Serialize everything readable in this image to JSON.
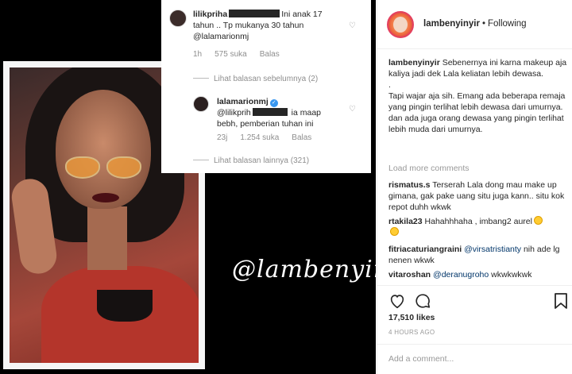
{
  "overlay": {
    "comment1": {
      "username": "lilikpriha",
      "text_before": "Ini anak 17",
      "text_line2": "tahun .. Tp mukanya 30 tahun",
      "text_line3": "@lalamarionmj",
      "age": "1h",
      "likes": "575 suka",
      "reply": "Balas"
    },
    "prev_replies": "Lihat balasan sebelumnya (2)",
    "comment2": {
      "username": "lalamarionmj",
      "verified_icon": "✓",
      "text_line1_mention": "@lilikprih",
      "text_line1_rest": "ia maap",
      "text_line2": "bebh, pemberian tuhan ini",
      "age": "23j",
      "likes": "1.254 suka",
      "reply": "Balas"
    },
    "more_replies": "Lihat balasan lainnya (321)"
  },
  "watermark": "@lambenyinyir",
  "post": {
    "username": "lambenyinyir",
    "separator": "•",
    "follow_label": "Following",
    "caption_user": "lambenyinyir",
    "caption_line1": "Sebenernya ini karna makeup aja kaliya jadi dek Lala keliatan lebih dewasa.",
    "caption_dot": ".",
    "caption_line2": "Tapi wajar aja sih. Emang ada beberapa remaja yang pingin terlihat lebih dewasa dari umurnya. dan ada juga orang dewasa yang pingin terlihat lebih muda dari umurnya.",
    "load_more": "Load more comments",
    "comments": [
      {
        "user": "rismatus.s",
        "text": "Terserah Lala dong mau make up gimana, gak pake uang situ juga kann.. situ kok repot duhh wkwk"
      },
      {
        "user": "rtakila23",
        "text": "Hahahhhaha , imbang2 aurel"
      },
      {
        "user": "fitriacaturiangraini",
        "mention": "@virsatristianty",
        "text": "nih ade lg nenen wkwk"
      },
      {
        "user": "vitaroshan",
        "mention": "@deranugroho",
        "text": "wkwkwkwk"
      }
    ],
    "likes": "17,510 likes",
    "time": "4 HOURS AGO",
    "add_comment_placeholder": "Add a comment..."
  },
  "colors": {
    "link": "#003569",
    "muted": "#999999",
    "verified": "#3897f0"
  }
}
